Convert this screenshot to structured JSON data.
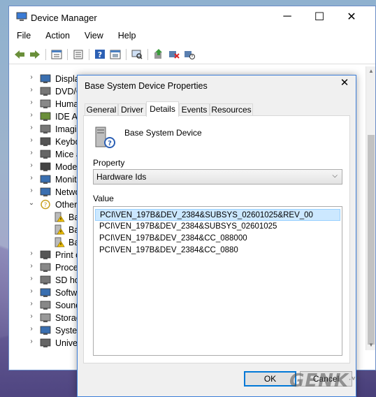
{
  "main_window": {
    "title": "Device Manager",
    "controls": {
      "minimize": "─",
      "maximize": "☐",
      "close": "✕"
    },
    "menu": [
      "File",
      "Action",
      "View",
      "Help"
    ],
    "toolbar_icons": [
      "back-icon",
      "forward-icon",
      "properties-view-icon",
      "details-icon",
      "help-icon",
      "show-hidden-icon",
      "scan-hardware-icon",
      "update-driver-icon",
      "uninstall-icon",
      "disable-icon"
    ],
    "tree": [
      {
        "label": "Display adapters",
        "chevron": "›"
      },
      {
        "label": "DVD/C",
        "chevron": "›"
      },
      {
        "label": "Huma",
        "chevron": "›"
      },
      {
        "label": "IDE AT",
        "chevron": "›"
      },
      {
        "label": "Imagin",
        "chevron": "›"
      },
      {
        "label": "Keybo",
        "chevron": "›"
      },
      {
        "label": "Mice a",
        "chevron": "›"
      },
      {
        "label": "Mode",
        "chevron": "›"
      },
      {
        "label": "Monit",
        "chevron": "›"
      },
      {
        "label": "Netwo",
        "chevron": "›"
      },
      {
        "label": "Other",
        "chevron": "⌄"
      },
      {
        "label": "Ba",
        "child": true
      },
      {
        "label": "Ba",
        "child": true
      },
      {
        "label": "Ba",
        "child": true
      },
      {
        "label": "Print c",
        "chevron": "›"
      },
      {
        "label": "Proces",
        "chevron": "›"
      },
      {
        "label": "SD ho",
        "chevron": "›"
      },
      {
        "label": "Softw",
        "chevron": "›"
      },
      {
        "label": "Sound",
        "chevron": "›"
      },
      {
        "label": "Storag",
        "chevron": "›"
      },
      {
        "label": "Syster",
        "chevron": "›"
      },
      {
        "label": "Univer",
        "chevron": "›"
      }
    ]
  },
  "dialog": {
    "title": "Base System Device Properties",
    "close": "✕",
    "tabs": [
      "General",
      "Driver",
      "Details",
      "Events",
      "Resources"
    ],
    "active_tab": "Details",
    "device_name": "Base System Device",
    "property_label": "Property",
    "property_value": "Hardware Ids",
    "value_label": "Value",
    "values": [
      "PCI\\VEN_197B&DEV_2384&SUBSYS_02601025&REV_00",
      "PCI\\VEN_197B&DEV_2384&SUBSYS_02601025",
      "PCI\\VEN_197B&DEV_2384&CC_088000",
      "PCI\\VEN_197B&DEV_2384&CC_0880"
    ],
    "ok_label": "OK",
    "cancel_label": "Cancel"
  },
  "watermark": {
    "text": "GENK",
    "suffix": ".vn"
  },
  "colors": {
    "accent": "#0078d7",
    "selection": "#cce8ff",
    "window_border": "#3b7dd8"
  }
}
